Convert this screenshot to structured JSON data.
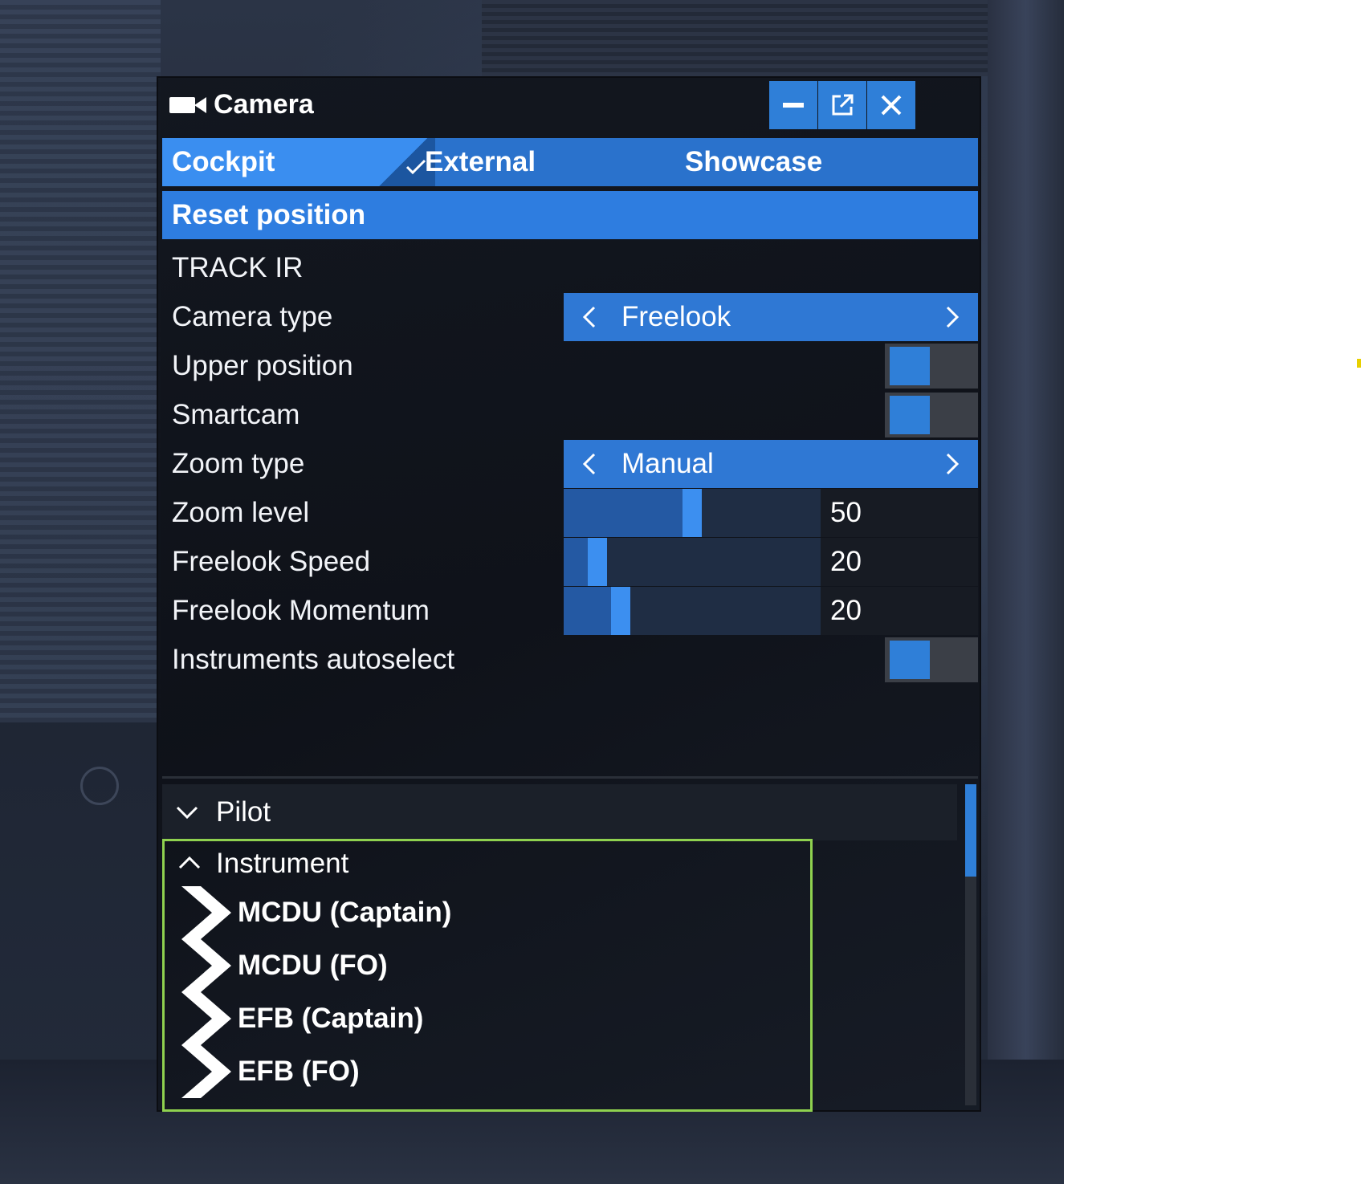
{
  "window": {
    "title": "Camera",
    "buttons": {
      "minimize": "minimize-icon",
      "popout": "popout-icon",
      "close": "close-icon"
    }
  },
  "tabs": [
    {
      "label": "Cockpit",
      "active": true
    },
    {
      "label": "External",
      "active": false
    },
    {
      "label": "Showcase",
      "active": false
    }
  ],
  "reset": {
    "label": "Reset position"
  },
  "settings": {
    "track_ir": {
      "label": "TRACK IR"
    },
    "camera_type": {
      "label": "Camera type",
      "value": "Freelook"
    },
    "upper_position": {
      "label": "Upper position",
      "on": true
    },
    "smartcam": {
      "label": "Smartcam",
      "on": true
    },
    "zoom_type": {
      "label": "Zoom type",
      "value": "Manual"
    },
    "zoom_level": {
      "label": "Zoom level",
      "value": "50",
      "fraction": 0.5
    },
    "freelook_speed": {
      "label": "Freelook Speed",
      "value": "20",
      "fraction": 0.1
    },
    "freelook_momentum": {
      "label": "Freelook Momentum",
      "value": "20",
      "fraction": 0.2
    },
    "instruments_autoselect": {
      "label": "Instruments autoselect",
      "on": true
    }
  },
  "views": {
    "pilot": {
      "label": "Pilot",
      "expanded": false
    },
    "instrument": {
      "label": "Instrument",
      "expanded": true,
      "items": [
        "MCDU (Captain)",
        "MCDU (FO)",
        "EFB (Captain)",
        "EFB (FO)"
      ]
    }
  },
  "colors": {
    "accent": "#2f7fd8",
    "tab_active": "#3a8ef0",
    "highlight_border": "#8fd14f"
  }
}
